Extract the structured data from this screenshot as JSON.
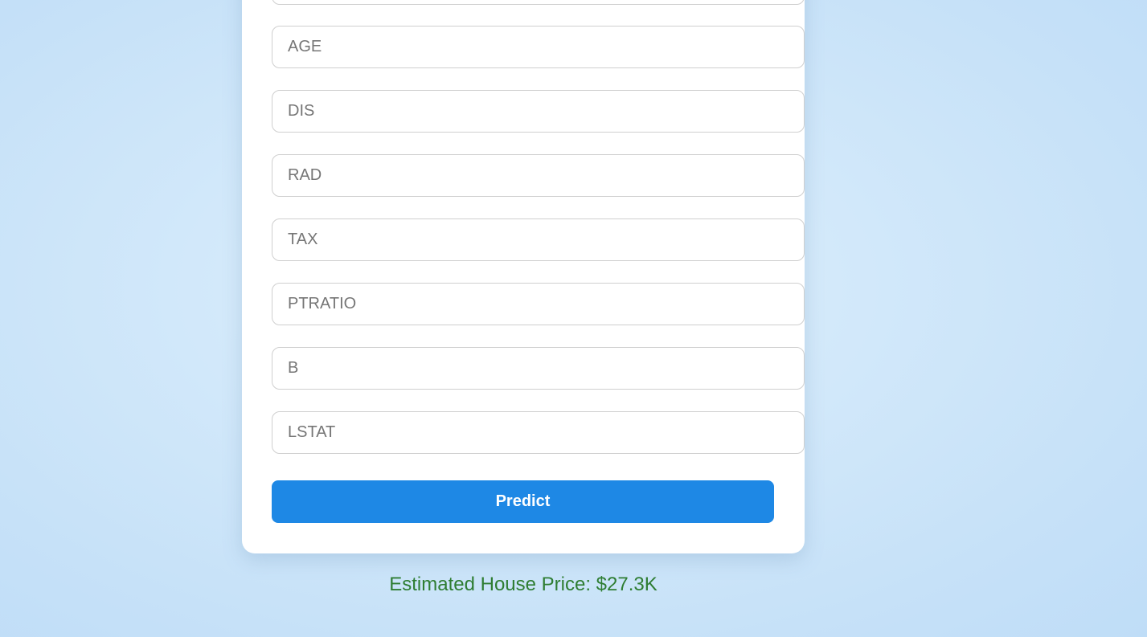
{
  "form": {
    "fields": [
      {
        "placeholder": "AGE"
      },
      {
        "placeholder": "DIS"
      },
      {
        "placeholder": "RAD"
      },
      {
        "placeholder": "TAX"
      },
      {
        "placeholder": "PTRATIO"
      },
      {
        "placeholder": "B"
      },
      {
        "placeholder": "LSTAT"
      }
    ],
    "submit_label": "Predict"
  },
  "result": {
    "text": "Estimated House Price: $27.3K",
    "color": "#2e7d32"
  },
  "colors": {
    "accent": "#1e88e5",
    "background": "#cfe6fa"
  }
}
